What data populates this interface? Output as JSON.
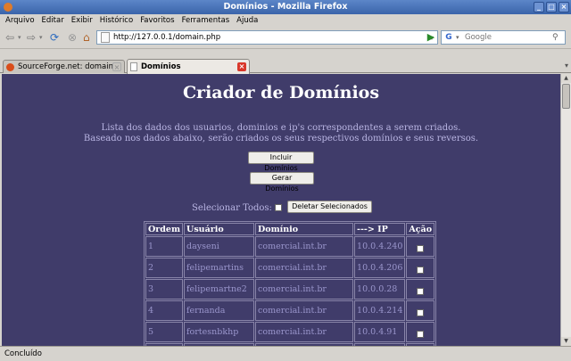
{
  "window": {
    "title": "Domínios - Mozilla Firefox",
    "buttons": [
      "_",
      "□",
      "×"
    ]
  },
  "menu": [
    "Arquivo",
    "Editar",
    "Exibir",
    "Histórico",
    "Favoritos",
    "Ferramentas",
    "Ajuda"
  ],
  "navigation": {
    "url": "http://127.0.0.1/domain.php",
    "search_placeholder": "Google",
    "icons": [
      "back-arrow-icon",
      "forward-arrow-icon",
      "reload-icon",
      "stop-icon",
      "home-icon",
      "go-arrow-icon",
      "search-icon"
    ]
  },
  "tabs": [
    {
      "label": "SourceForge.net: domainc...",
      "active": false
    },
    {
      "label": "Domínios",
      "active": true
    }
  ],
  "page": {
    "title": "Criador de Domínios",
    "desc_line1": "Lista dos dados dos usuarios, dominios e ip's correspondentes a serem criados.",
    "desc_line2": "Baseado nos dados abaixo, serão criados os seus respectivos domínios e seus reversos.",
    "btn_incluir": "Incluir Domínios",
    "btn_gerar": "Gerar Domínios",
    "select_all_label": "Selecionar Todos:",
    "btn_deletar": "Deletar Selecionados",
    "table": {
      "headers": [
        "Ordem",
        "Usuário",
        "Domínio",
        "---> IP",
        "Ação"
      ],
      "rows": [
        {
          "ordem": "1",
          "usuario": "dayseni",
          "dominio": "comercial.int.br",
          "ip": "10.0.4.240"
        },
        {
          "ordem": "2",
          "usuario": "felipemartins",
          "dominio": "comercial.int.br",
          "ip": "10.0.4.206"
        },
        {
          "ordem": "3",
          "usuario": "felipemartne2",
          "dominio": "comercial.int.br",
          "ip": "10.0.0.28"
        },
        {
          "ordem": "4",
          "usuario": "fernanda",
          "dominio": "comercial.int.br",
          "ip": "10.0.4.214"
        },
        {
          "ordem": "5",
          "usuario": "fortesnbkhp",
          "dominio": "comercial.int.br",
          "ip": "10.0.4.91"
        }
      ]
    }
  },
  "status": "Concluído",
  "colors": {
    "page_bg": "#403c6a",
    "title_fg": "#ffffff",
    "text_fg": "#b9b5e3",
    "cell_fg": "#9a96cc"
  }
}
